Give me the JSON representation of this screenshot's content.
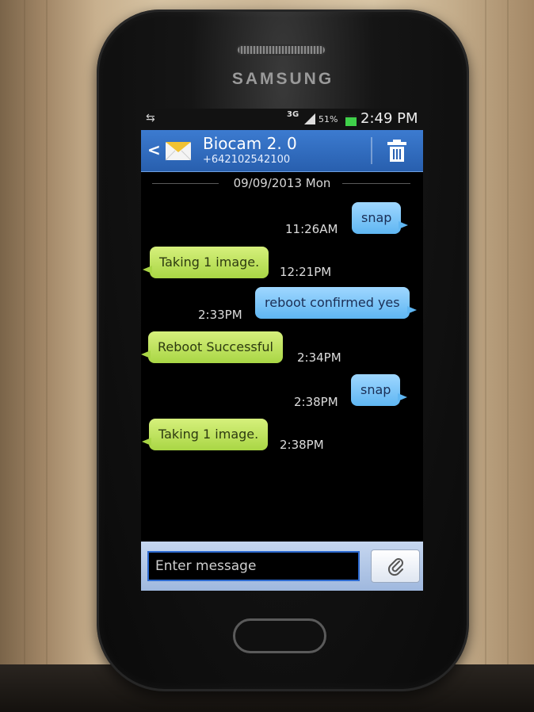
{
  "device": {
    "brand": "SAMSUNG"
  },
  "status_bar": {
    "network": "3G",
    "battery_percent": "51%",
    "time": "2:49 PM",
    "battery_color": "#3fd04a"
  },
  "header": {
    "contact_name": "Biocam 2. 0",
    "contact_number": "+642102542100",
    "accent_color": "#3c7bd0",
    "icons": [
      "back-icon",
      "envelope-icon",
      "trash-icon"
    ]
  },
  "conversation": {
    "date": "09/09/2013 Mon",
    "messages": [
      {
        "direction": "sent",
        "text": "snap",
        "time": "11:26AM"
      },
      {
        "direction": "received",
        "text": "Taking 1 image.",
        "time": "12:21PM"
      },
      {
        "direction": "sent",
        "text": "reboot confirmed yes",
        "time": "2:33PM"
      },
      {
        "direction": "received",
        "text": "Reboot Successful",
        "time": "2:34PM"
      },
      {
        "direction": "sent",
        "text": "snap",
        "time": "2:38PM"
      },
      {
        "direction": "received",
        "text": "Taking 1 image.",
        "time": "2:38PM"
      }
    ],
    "sent_color": "#5fb6f2",
    "received_color": "#a9d645"
  },
  "composer": {
    "placeholder": "Enter message",
    "value": "",
    "attach_icon": "paperclip-icon"
  }
}
